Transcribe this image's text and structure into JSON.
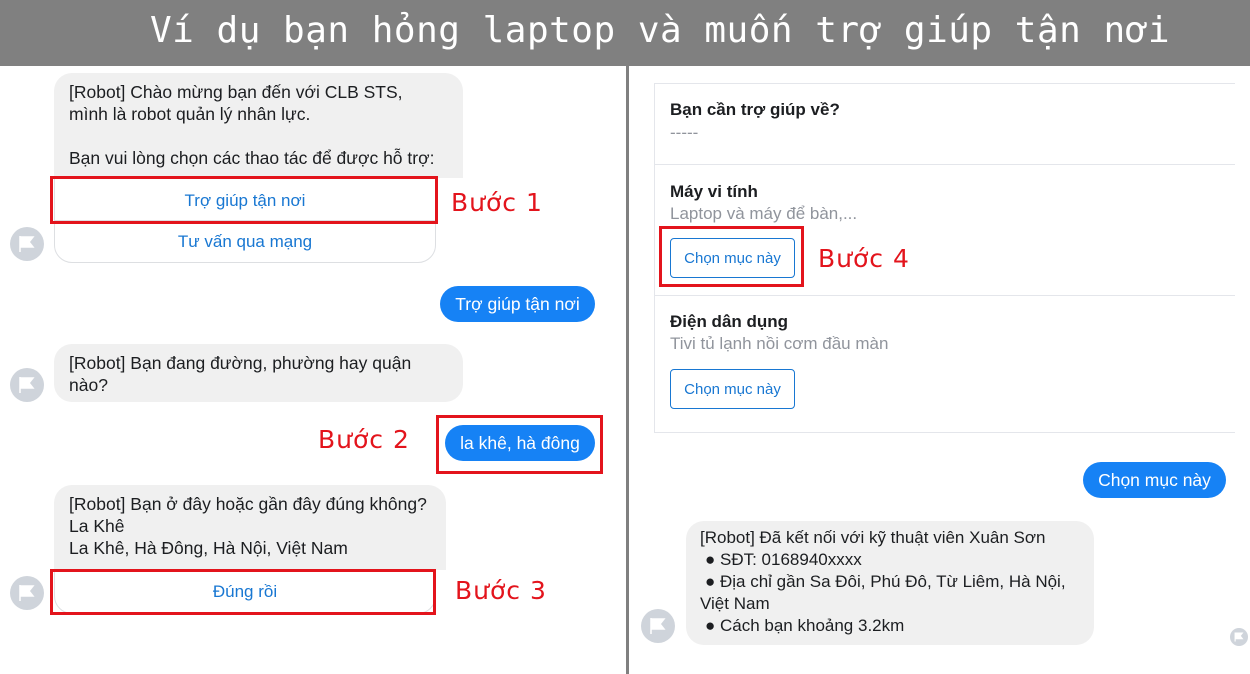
{
  "banner": {
    "title": "Ví dụ bạn hỏng laptop và muốn trợ giúp tận nơi"
  },
  "left": {
    "msg1": {
      "lines": [
        "[Robot] Chào mừng bạn đến với CLB STS,",
        "mình là robot quản lý nhân lực.",
        "Bạn vui lòng chọn các thao tác để được hỗ trợ:"
      ],
      "buttons": [
        "Trợ giúp tận nơi",
        "Tư vấn qua mạng"
      ]
    },
    "user1": "Trợ giúp tận nơi",
    "msg2": {
      "lines": [
        "[Robot] Bạn đang đường, phường hay quận",
        "nào?"
      ]
    },
    "user2": "la khê, hà đông",
    "msg3": {
      "lines": [
        "[Robot] Bạn ở đây hoặc gần đây đúng không?",
        "La Khê",
        "La Khê, Hà Đông, Hà Nội, Việt Nam"
      ],
      "button": "Đúng rồi"
    }
  },
  "right": {
    "card": {
      "sections": [
        {
          "title": "Bạn cần trợ giúp về?",
          "subtitle": "-----"
        },
        {
          "title": "Máy vi tính",
          "subtitle": "Laptop và máy để bàn,...",
          "button": "Chọn mục này"
        },
        {
          "title": "Điện dân dụng",
          "subtitle": "Tivi tủ lạnh nồi cơm đầu màn",
          "button": "Chọn mục này"
        }
      ]
    },
    "user3": "Chọn mục này",
    "msg4": {
      "lines": [
        "[Robot] Đã kết nối với kỹ thuật viên Xuân Sơn",
        "● SĐT: 0168940xxxx",
        "● Địa chỉ gần Sa Đôi, Phú Đô, Từ Liêm, Hà Nội,",
        "Việt Nam",
        "● Cách bạn khoảng 3.2km"
      ]
    }
  },
  "steps": [
    "Bước  1",
    "Bước  2",
    "Bước  3",
    "Bước  4"
  ],
  "colors": {
    "banner": "#808080",
    "accent_blue": "#1682f5",
    "annotation_red": "#e3141c"
  }
}
